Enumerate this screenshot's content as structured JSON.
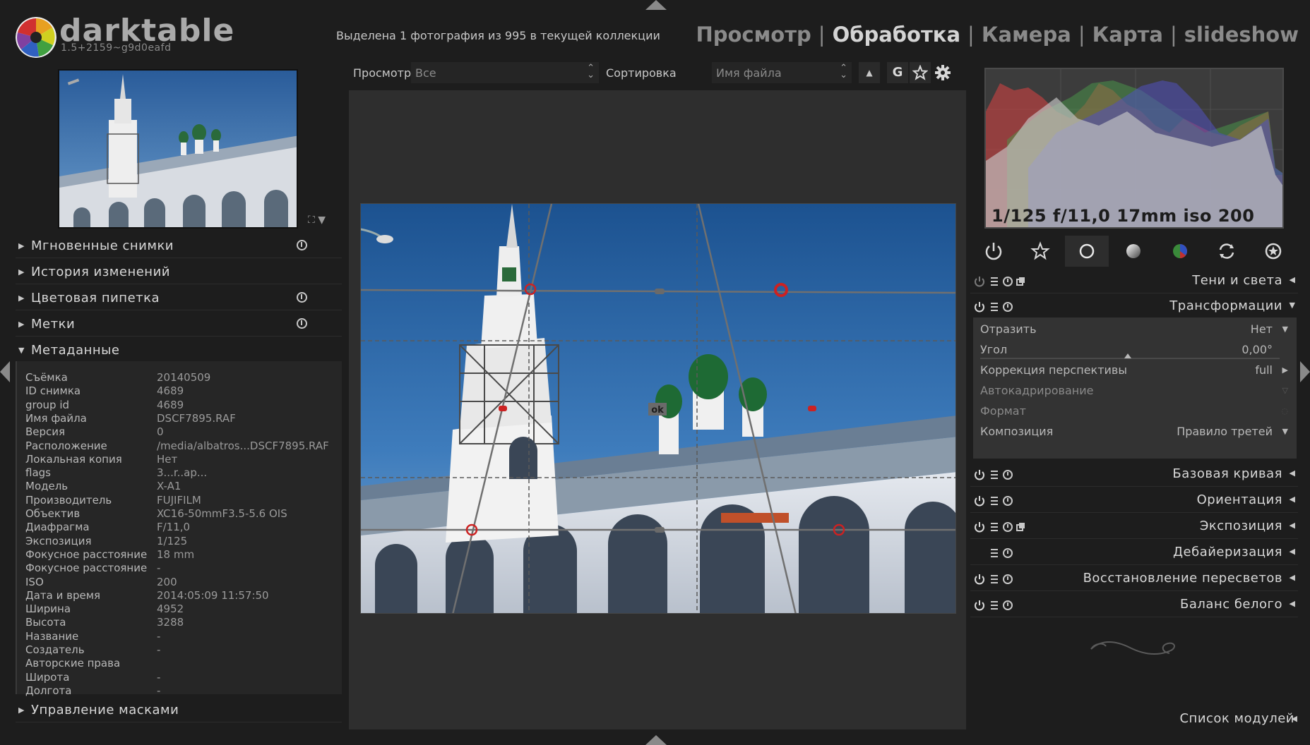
{
  "app": {
    "name": "darktable",
    "version": "1.5+2159~g9d0eafd"
  },
  "header": {
    "selection_info": "Выделена 1 фотография из 995 в текущей коллекции"
  },
  "views": [
    {
      "label": "Просмотр",
      "active": false
    },
    {
      "label": "Обработка",
      "active": true
    },
    {
      "label": "Камера",
      "active": false
    },
    {
      "label": "Карта",
      "active": false
    },
    {
      "label": "slideshow",
      "active": false
    }
  ],
  "filterbar": {
    "view_label": "Просмотр",
    "view_value": "Все",
    "sort_label": "Сортировка",
    "sort_value": "Имя файла",
    "sort_dir": "▲",
    "g_button": "G"
  },
  "left_sections": [
    {
      "title": "Мгновенные снимки",
      "expanded": false,
      "has_reset": true
    },
    {
      "title": "История изменений",
      "expanded": false,
      "has_reset": false
    },
    {
      "title": "Цветовая пипетка",
      "expanded": false,
      "has_reset": true
    },
    {
      "title": "Метки",
      "expanded": false,
      "has_reset": true
    },
    {
      "title": "Метаданные",
      "expanded": true,
      "has_reset": false
    }
  ],
  "metadata": [
    {
      "k": "Съёмка",
      "v": "20140509"
    },
    {
      "k": "ID снимка",
      "v": "4689"
    },
    {
      "k": "group id",
      "v": "4689"
    },
    {
      "k": "Имя файла",
      "v": "DSCF7895.RAF"
    },
    {
      "k": "Версия",
      "v": "0"
    },
    {
      "k": "Расположение",
      "v": "/media/albatros...DSCF7895.RAF"
    },
    {
      "k": "Локальная копия",
      "v": "Нет"
    },
    {
      "k": "flags",
      "v": "3...r..ap..."
    },
    {
      "k": "Модель",
      "v": "X-A1"
    },
    {
      "k": "Производитель",
      "v": "FUJIFILM"
    },
    {
      "k": "Объектив",
      "v": "XC16-50mmF3.5-5.6 OIS"
    },
    {
      "k": "Диафрагма",
      "v": "F/11,0"
    },
    {
      "k": "Экспозиция",
      "v": "1/125"
    },
    {
      "k": "Фокусное расстояние",
      "v": "18 mm"
    },
    {
      "k": "Фокусное расстояние",
      "v": "-"
    },
    {
      "k": "ISO",
      "v": "200"
    },
    {
      "k": "Дата и время",
      "v": "2014:05:09 11:57:50"
    },
    {
      "k": "Ширина",
      "v": "4952"
    },
    {
      "k": "Высота",
      "v": "3288"
    },
    {
      "k": "Название",
      "v": "-"
    },
    {
      "k": "Создатель",
      "v": "-"
    },
    {
      "k": "Авторские права",
      "v": ""
    },
    {
      "k": "Широта",
      "v": "-"
    },
    {
      "k": "Долгота",
      "v": "-"
    }
  ],
  "mask_section": {
    "title": "Управление масками"
  },
  "histogram": {
    "info": "1/125 f/11,0 17mm iso 200"
  },
  "group_tabs": [
    {
      "name": "power-icon"
    },
    {
      "name": "star-icon"
    },
    {
      "name": "circle-icon",
      "active": true
    },
    {
      "name": "tone-icon"
    },
    {
      "name": "color-icon"
    },
    {
      "name": "correct-icon"
    },
    {
      "name": "effect-icon"
    }
  ],
  "modules_top": [
    {
      "title": "Тени и света",
      "arrow": "◀",
      "has_power": true,
      "dim_power": true,
      "has_multi": true
    },
    {
      "title": "Трансформации",
      "arrow": "▼",
      "has_power": true,
      "has_multi": false
    }
  ],
  "transform": {
    "rows": [
      {
        "k": "Отразить",
        "v": "Нет",
        "dd": "▼"
      },
      {
        "k": "Угол",
        "v": "0,00°",
        "dd": ""
      },
      {
        "k": "Коррекция перспективы",
        "v": "full",
        "dd": "▶"
      },
      {
        "k": "Автокадрирование",
        "v": "",
        "dd": "▽"
      },
      {
        "k": "Формат",
        "v": "",
        "dd": ""
      },
      {
        "k": "Композиция",
        "v": "Правило третей",
        "dd": "▼"
      }
    ],
    "angle_slider": 0.5
  },
  "modules_bottom": [
    {
      "title": "Базовая кривая",
      "has_power": true,
      "has_multi": false
    },
    {
      "title": "Ориентация",
      "has_power": true,
      "has_multi": false
    },
    {
      "title": "Экспозиция",
      "has_power": true,
      "has_multi": true
    },
    {
      "title": "Дебайеризация",
      "has_power": false,
      "has_multi": false
    },
    {
      "title": "Восстановление пересветов",
      "has_power": true,
      "has_multi": false
    },
    {
      "title": "Баланс белого",
      "has_power": true,
      "has_multi": false
    }
  ],
  "module_list": {
    "title": "Список модулей"
  },
  "crop": {
    "ok_label": "ok"
  }
}
